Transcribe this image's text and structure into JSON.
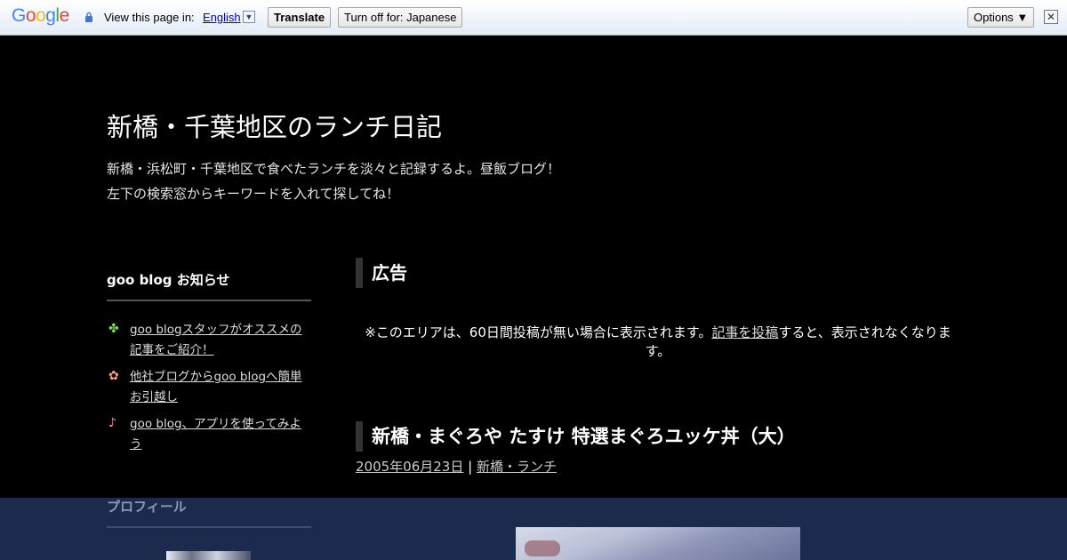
{
  "translate_bar": {
    "logo_letters": [
      "G",
      "o",
      "o",
      "g",
      "l",
      "e"
    ],
    "view_text": "View this page in:",
    "language": "English",
    "dropdown_glyph": "▼",
    "translate_label": "Translate",
    "turn_off_label": "Turn off for: Japanese",
    "options_label": "Options ▼",
    "close_glyph": "✕"
  },
  "blog": {
    "title": "新橋・千葉地区のランチ日記",
    "description_line1": "新橋・浜松町・千葉地区で食べたランチを淡々と記録するよ。昼飯ブログ！",
    "description_line2": "左下の検索窓からキーワードを入れて探してね！"
  },
  "sidebar": {
    "notice_heading": "goo blog お知らせ",
    "items": [
      {
        "label": "goo blogスタッフがオススメの記事をご紹介！",
        "icon": "clover-icon",
        "glyph": "✤",
        "color": "#7ddc4c"
      },
      {
        "label": "他社ブログからgoo blogへ簡単お引越し",
        "icon": "flower-icon",
        "glyph": "✿",
        "color": "#f6a38a"
      },
      {
        "label": "goo blog、アプリを使ってみよう",
        "icon": "music-note-icon",
        "glyph": "♪",
        "color": "#ff7fc1"
      }
    ],
    "profile_heading": "プロフィール"
  },
  "main": {
    "ad_heading": "広告",
    "ad_note_before": "※このエリアは、60日間投稿が無い場合に表示されます。",
    "ad_note_link": "記事を投稿",
    "ad_note_after": "すると、表示されなくなります。",
    "post_title": "新橋・まぐろや たすけ 特選まぐろユッケ丼（大）",
    "post_date": "2005年06月23日",
    "separator": " | ",
    "post_category": "新橋・ランチ"
  },
  "colors": {
    "background": "#000000",
    "footer_navy": "#1c2a4d",
    "heading_bar": "#333333"
  }
}
